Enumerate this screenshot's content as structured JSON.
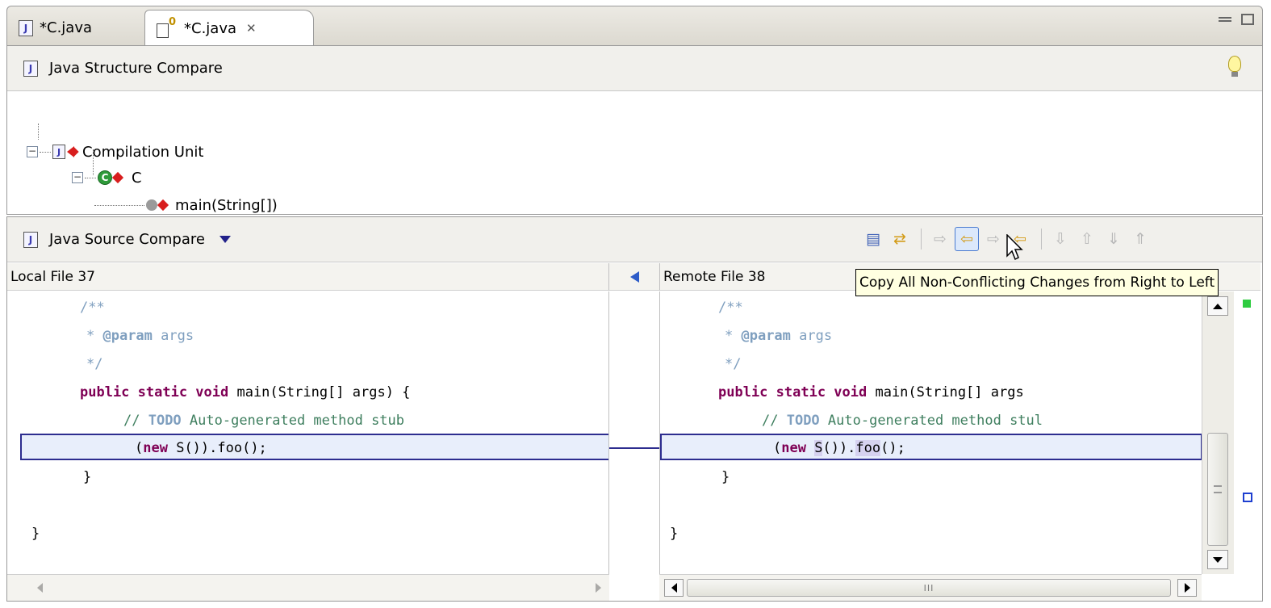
{
  "tabs": [
    {
      "label": "*C.java",
      "icon": "java-file-icon",
      "active": false
    },
    {
      "label": "*C.java",
      "icon": "compare-editor-icon",
      "active": true,
      "close": "✕"
    }
  ],
  "structure_pane": {
    "title": "Java Structure Compare",
    "tree": [
      {
        "label": "Compilation Unit",
        "icon": "java-file-icon",
        "level": 0
      },
      {
        "label": "C",
        "icon": "class-icon",
        "level": 1
      },
      {
        "label": "main(String[])",
        "icon": "method-icon",
        "level": 2
      }
    ]
  },
  "source_pane": {
    "title": "Java Source Compare",
    "toolbar_icons": [
      "layout-toggle-icon",
      "swap-sides-icon",
      "copy-all-left-to-right-icon",
      "copy-all-non-conflicting-right-to-left-icon",
      "copy-current-left-to-right-icon",
      "copy-current-right-to-left-icon",
      "next-difference-icon",
      "previous-difference-icon",
      "next-change-icon",
      "previous-change-icon"
    ],
    "left": {
      "header": "Local File 37"
    },
    "right": {
      "header": "Remote File 38"
    },
    "tooltip": "Copy All Non-Conflicting Changes from Right to Left",
    "hscroll_grip": "III",
    "code_left": {
      "l1": "/**",
      "l2_pre": "* ",
      "l2_tag": "@param",
      "l2_post": " args",
      "l3": "*/",
      "l4_kw": "public static void",
      "l4_rest": " main(String[] args) {",
      "l5_pre": "// ",
      "l5_todo": "TODO",
      "l5_post": " Auto-generated method stub",
      "l6_open": "(",
      "l6_kw": "new",
      "l6_rest": " S()).foo();",
      "l7": "}",
      "l9": "}"
    },
    "code_right": {
      "l1": "/**",
      "l2_pre": "* ",
      "l2_tag": "@param",
      "l2_post": " args",
      "l3": "*/",
      "l4_kw": "public static void",
      "l4_rest": " main(String[] args",
      "l5_pre": "// ",
      "l5_todo": "TODO",
      "l5_post": " Auto-generated method stul",
      "l6_open": "(",
      "l6_kw": "new",
      "l6_sp": " ",
      "l6_s": "S",
      "l6_mid": "()).",
      "l6_foo": "foo",
      "l6_end": "();",
      "l7": "}",
      "l9": "}"
    }
  },
  "colors": {
    "keyword": "#7f0055",
    "comment": "#3f7f5f",
    "javadoc": "#7f9fbf",
    "diff_border": "#2d2d8f",
    "diff_fill": "#e8eefb",
    "tooltip_bg": "#ffffe1"
  }
}
